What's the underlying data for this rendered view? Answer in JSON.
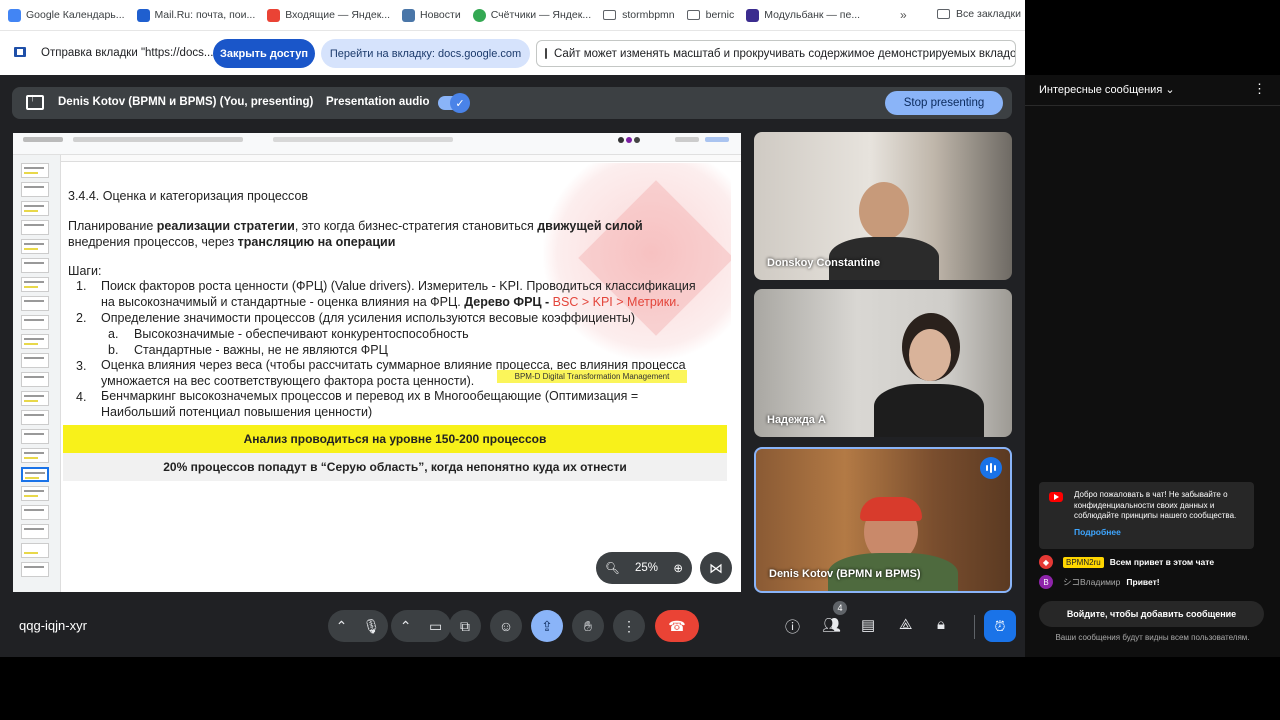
{
  "bookmarks": {
    "items": [
      {
        "label": "Google Календарь...",
        "color": "#4285f4"
      },
      {
        "label": "Mail.Ru: почта, пои...",
        "color": "#1f5fcf"
      },
      {
        "label": "Входящие — Яндек...",
        "color": "#ea4335"
      },
      {
        "label": "Новости",
        "color": "#4a76a8"
      },
      {
        "label": "Счётчики — Яндек...",
        "color": "#34a853"
      },
      {
        "label": "stormbpmn",
        "color": "#5f6368"
      },
      {
        "label": "bernic",
        "color": "#5f6368"
      },
      {
        "label": "Модульбанк — пе...",
        "color": "#3b2c8f"
      }
    ],
    "more": "»",
    "all_label": "Все закладки"
  },
  "share_bar": {
    "text": "Отправка вкладки \"https://docs....",
    "close_access": "Закрыть доступ",
    "goto_tab": "Перейти на вкладку: docs.google.com",
    "notice": "Сайт может изменять масштаб и прокручивать содержимое демонстрируемых вкладок"
  },
  "presenting": {
    "name": "Denis Kotov (BPMN и BPMS) (You, presenting)",
    "audio_label": "Presentation audio",
    "stop_label": "Stop presenting"
  },
  "slide": {
    "title": "3.4.4. Оценка и категоризация процессов",
    "intro_a": "Планирование ",
    "intro_b": "реализации стратегии",
    "intro_c": ", это когда бизнес-стратегия становиться ",
    "intro_d": "движущей силой",
    "intro_e": "внедрения процессов, через ",
    "intro_f": "трансляцию на операции",
    "steps_header": "Шаги:",
    "step1_line1": "Поиск факторов роста ценности (ФРЦ) (Value drivers). Измеритель - KPI. Проводиться классификация",
    "step1_line2_a": "на высокозначимый и стандартные - оценка влияния на ФРЦ. ",
    "step1_line2_b": "Дерево ФРЦ - ",
    "step1_line2_c": "BSC > KPI > Метрики.",
    "step2": "Определение значимости процессов (для усиления используются весовые коэффициенты)",
    "step2a": "Высокозначимые - обеспечивают конкурентоспособность",
    "step2b": "Стандартные - важны, не не являются ФРЦ",
    "step3_line1": "Оценка влияния через веса (чтобы рассчитать суммарное влияние процесса, вес влияния процесса",
    "step3_line2": "умножается на вес соответствующего фактора роста ценности).",
    "highlight_note": "BPM-D Digital Transformation Management",
    "step4_line1": "Бенчмаркинг высокозначемых процессов и перевод их в Многообещающие (Оптимизация =",
    "step4_line2": "Наибольший потенциал повышения ценности)",
    "num1": "1.",
    "num2": "2.",
    "num3": "3.",
    "num4": "4.",
    "suba": "a.",
    "subb": "b.",
    "yellow_band": "Анализ проводиться на уровне 150-200 процессов",
    "grey_band": "20% процессов попадут в “Серую область”, когда непонятно куда их отнести",
    "zoom_level": "25%"
  },
  "participants": [
    {
      "name": "Donskoy Constantine"
    },
    {
      "name": "Надежда А"
    },
    {
      "name": "Denis Kotov (BPMN и BPMS)"
    }
  ],
  "bottom_bar": {
    "meeting_code": "qqg-iqjn-xyr",
    "participants_count": "4"
  },
  "chat": {
    "header": "Интересные сообщения",
    "welcome_text": "Добро пожаловать в чат! Не забывайте о конфиденциальности своих данных и соблюдайте принципы нашего сообщества.",
    "welcome_link": "Подробнее",
    "messages": [
      {
        "author": "BPMN2ru",
        "text": "Всем привет в этом чате",
        "avatar_color": "#e53935"
      },
      {
        "author": "シコВладимир",
        "text": "Привет!",
        "avatar_color": "#8e24aa",
        "avatar_letter": "В"
      }
    ],
    "input_label": "Войдите, чтобы добавить сообщение",
    "note": "Ваши сообщения будут видны всем пользователям."
  }
}
